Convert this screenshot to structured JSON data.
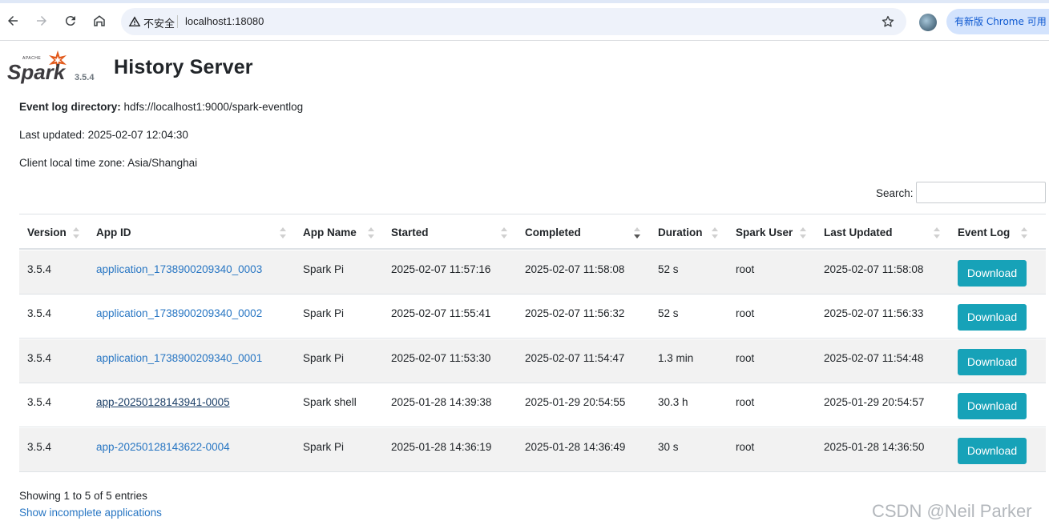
{
  "browser": {
    "insecure_label": "不安全",
    "url": "localhost1:18080",
    "update_label": "有新版 Chrome 可用"
  },
  "header": {
    "logo_text": "Spark",
    "logo_apache": "APACHE",
    "version": "3.5.4",
    "title": "History Server"
  },
  "info": {
    "event_log_label": "Event log directory:",
    "event_log_value": "hdfs://localhost1:9000/spark-eventlog",
    "last_updated": "Last updated: 2025-02-07 12:04:30",
    "timezone": "Client local time zone: Asia/Shanghai"
  },
  "search": {
    "label": "Search:",
    "value": ""
  },
  "table": {
    "columns": [
      "Version",
      "App ID",
      "App Name",
      "Started",
      "Completed",
      "Duration",
      "Spark User",
      "Last Updated",
      "Event Log"
    ],
    "rows": [
      {
        "version": "3.5.4",
        "app_id": "application_1738900209340_0003",
        "app_name": "Spark Pi",
        "started": "2025-02-07 11:57:16",
        "completed": "2025-02-07 11:58:08",
        "duration": "52 s",
        "user": "root",
        "last_updated": "2025-02-07 11:58:08",
        "download": "Download"
      },
      {
        "version": "3.5.4",
        "app_id": "application_1738900209340_0002",
        "app_name": "Spark Pi",
        "started": "2025-02-07 11:55:41",
        "completed": "2025-02-07 11:56:32",
        "duration": "52 s",
        "user": "root",
        "last_updated": "2025-02-07 11:56:33",
        "download": "Download"
      },
      {
        "version": "3.5.4",
        "app_id": "application_1738900209340_0001",
        "app_name": "Spark Pi",
        "started": "2025-02-07 11:53:30",
        "completed": "2025-02-07 11:54:47",
        "duration": "1.3 min",
        "user": "root",
        "last_updated": "2025-02-07 11:54:48",
        "download": "Download"
      },
      {
        "version": "3.5.4",
        "app_id": "app-20250128143941-0005",
        "app_name": "Spark shell",
        "started": "2025-01-28 14:39:38",
        "completed": "2025-01-29 20:54:55",
        "duration": "30.3 h",
        "user": "root",
        "last_updated": "2025-01-29 20:54:57",
        "download": "Download"
      },
      {
        "version": "3.5.4",
        "app_id": "app-20250128143622-0004",
        "app_name": "Spark Pi",
        "started": "2025-01-28 14:36:19",
        "completed": "2025-01-28 14:36:49",
        "duration": "30 s",
        "user": "root",
        "last_updated": "2025-01-28 14:36:50",
        "download": "Download"
      }
    ],
    "sorted_column": "Completed",
    "sort_direction": "descending"
  },
  "footer": {
    "entries": "Showing 1 to 5 of 5 entries",
    "incomplete_link": "Show incomplete applications"
  },
  "watermark": "CSDN @Neil Parker",
  "colors": {
    "link": "#2876c3",
    "button": "#17a2b8",
    "stripe": "#f2f2f2"
  }
}
